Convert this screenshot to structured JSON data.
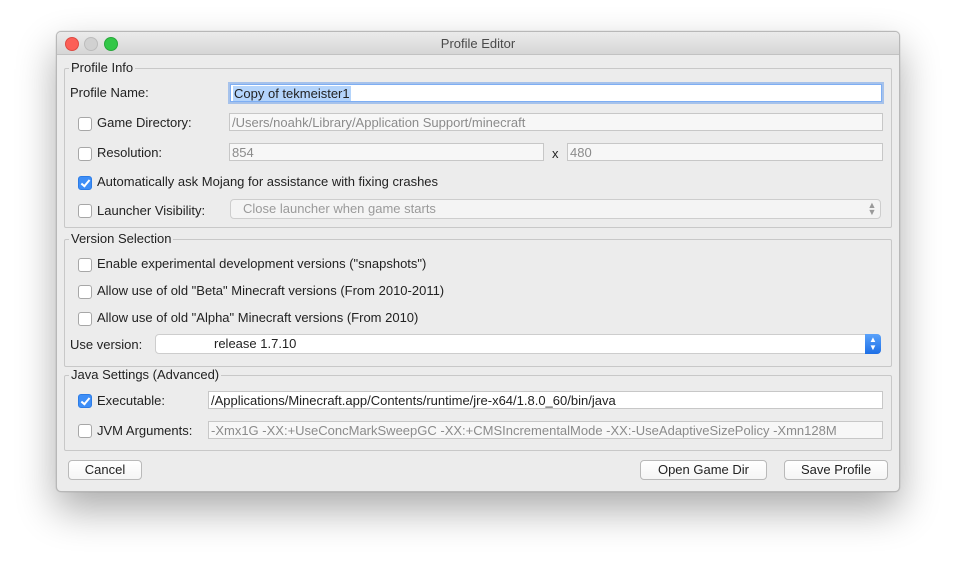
{
  "window": {
    "title": "Profile Editor"
  },
  "profile_info": {
    "legend": "Profile Info",
    "profile_name_label": "Profile Name:",
    "profile_name_value": "Copy of tekmeister1",
    "game_directory_label": "Game Directory:",
    "game_directory_value": "/Users/noahk/Library/Application Support/minecraft",
    "game_directory_checked": false,
    "resolution_label": "Resolution:",
    "resolution_width": "854",
    "resolution_x": "x",
    "resolution_height": "480",
    "resolution_checked": false,
    "mojang_assist_label": "Automatically ask Mojang for assistance with fixing crashes",
    "mojang_assist_checked": true,
    "launcher_visibility_label": "Launcher Visibility:",
    "launcher_visibility_value": "Close launcher when game starts",
    "launcher_visibility_checked": false
  },
  "version_selection": {
    "legend": "Version Selection",
    "snapshots_label": "Enable experimental development versions (\"snapshots\")",
    "beta_label": "Allow use of old \"Beta\" Minecraft versions (From 2010-2011)",
    "alpha_label": "Allow use of old \"Alpha\" Minecraft versions (From 2010)",
    "use_version_label": "Use version:",
    "use_version_value": "release 1.7.10"
  },
  "java_settings": {
    "legend": "Java Settings (Advanced)",
    "executable_label": "Executable:",
    "executable_checked": true,
    "executable_value": "/Applications/Minecraft.app/Contents/runtime/jre-x64/1.8.0_60/bin/java",
    "jvm_args_label": "JVM Arguments:",
    "jvm_args_checked": false,
    "jvm_args_value": "-Xmx1G -XX:+UseConcMarkSweepGC -XX:+CMSIncrementalMode -XX:-UseAdaptiveSizePolicy -Xmn128M"
  },
  "buttons": {
    "cancel": "Cancel",
    "open_game_dir": "Open Game Dir",
    "save_profile": "Save Profile"
  },
  "colors": {
    "checkbox_checked": "#3e8ef7",
    "close": "#fc5f57",
    "zoom": "#33c748",
    "selection": "#b4d4fb"
  }
}
